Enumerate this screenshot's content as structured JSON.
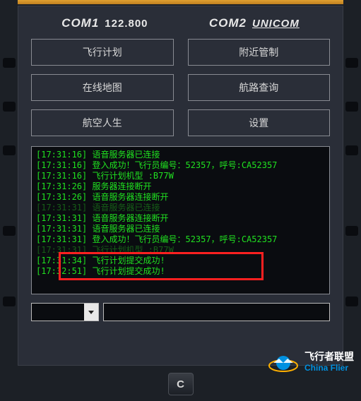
{
  "com": {
    "label1": "COM1",
    "value1": "122.800",
    "label2": "COM2",
    "value2": "UNICOM"
  },
  "buttons": {
    "b0": "飞行计划",
    "b1": "附近管制",
    "b2": "在线地图",
    "b3": "航路查询",
    "b4": "航空人生",
    "b5": "设置"
  },
  "log": {
    "l0": "[17:31:16] 语音服务器已连接",
    "l1": "[17:31:16] 登入成功！飞行员编号：52357，呼号:CA52357",
    "l2": "[17:31:16] 飞行计划机型 :B77W",
    "l3": "[17:31:26] 服务器连接断开",
    "l4": "[17:31:26] 语音服务器连接断开",
    "l5": "[17:31:31] 语音服务器已连接",
    "l6": "[17:31:31] 语音服务器连接断开",
    "l7": "[17:31:31] 语音服务器已连接",
    "l8": "[17:31:31] 登入成功！飞行员编号：52357，呼号:CA52357",
    "l9": "[17:31:31] 飞行计划机型 :B77W",
    "l10": "[17:31:34] 飞行计划提交成功!",
    "l11": "[17:32:51] 飞行计划提交成功!"
  },
  "inputs": {
    "small": "",
    "long": ""
  },
  "key": {
    "c": "C"
  },
  "watermark": {
    "zh": "飞行者联盟",
    "en": "China Flier"
  }
}
